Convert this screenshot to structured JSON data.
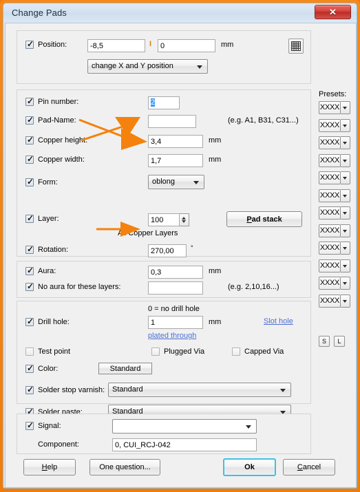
{
  "window": {
    "title": "Change Pads",
    "close_label": "✕",
    "accent_border": "#f0800f",
    "titlebar_color": "#d5e3f1",
    "close_color": "#c93a32"
  },
  "position_group": {
    "checkbox_label": "Position:",
    "checked": true,
    "x_value": "-8,5",
    "separator": "I",
    "y_value": "0",
    "unit": "mm",
    "mode_select": "change X and Y position",
    "grid_icon": "grid-icon"
  },
  "pad_group": {
    "pin_number": {
      "label": "Pin number:",
      "checked": true,
      "value": "2",
      "selected": true
    },
    "pad_name": {
      "label": "Pad-Name:",
      "checked": true,
      "value": "",
      "hint": "(e.g. A1, B31, C31...)"
    },
    "copper_height": {
      "label": "Copper height:",
      "checked": true,
      "value": "3,4",
      "unit": "mm"
    },
    "copper_width": {
      "label": "Copper width:",
      "checked": true,
      "value": "1,7",
      "unit": "mm"
    },
    "form": {
      "label": "Form:",
      "checked": true,
      "value": "oblong"
    },
    "layer": {
      "label": "Layer:",
      "checked": true,
      "value": "100",
      "caption": "All Copper Layers"
    },
    "pad_stack_button": {
      "accel": "P",
      "rest": "ad stack"
    },
    "rotation": {
      "label": "Rotation:",
      "checked": true,
      "value": "270,00",
      "unit": "°"
    }
  },
  "aura_group": {
    "aura": {
      "label": "Aura:",
      "checked": true,
      "value": "0,3",
      "unit": "mm"
    },
    "no_aura": {
      "label": "No aura for these layers:",
      "checked": true,
      "value": "",
      "hint": "(e.g. 2,10,16...)"
    }
  },
  "drill_group": {
    "caption": "0 = no drill hole",
    "drill_hole": {
      "label": "Drill hole:",
      "checked": true,
      "value": "1",
      "unit": "mm"
    },
    "slot_hole_link": "Slot hole",
    "plated_through_link": "plated through",
    "test_point": {
      "label": "Test point",
      "checked": false
    },
    "plugged_via": {
      "label": "Plugged Via",
      "checked": false
    },
    "capped_via": {
      "label": "Capped Via",
      "checked": false
    },
    "color": {
      "label": "Color:",
      "checked": true,
      "button": "Standard"
    },
    "solder_stop": {
      "label": "Solder stop varnish:",
      "checked": true,
      "value": "Standard"
    },
    "solder_paste": {
      "label": "Solder paste:",
      "checked": true,
      "value": "Standard"
    }
  },
  "signal_group": {
    "signal": {
      "label": "Signal:",
      "checked": true,
      "value": ""
    },
    "component": {
      "label": "Component:",
      "value": "0, CUI_RCJ-042"
    }
  },
  "presets": {
    "label": "Presets:",
    "items": [
      {
        "value": "XXXX"
      },
      {
        "value": "XXXX"
      },
      {
        "value": "XXXX"
      },
      {
        "value": "XXXX"
      },
      {
        "value": "XXXX"
      },
      {
        "value": "XXXX"
      },
      {
        "value": "XXXX"
      },
      {
        "value": "XXXX"
      },
      {
        "value": "XXXX"
      },
      {
        "value": "XXXX"
      },
      {
        "value": "XXXX"
      },
      {
        "value": "XXXX"
      }
    ],
    "save_button": "S",
    "load_button": "L"
  },
  "footer": {
    "help": {
      "accel": "H",
      "rest": "elp"
    },
    "one_question": "One question...",
    "ok": "Ok",
    "cancel": {
      "accel": "C",
      "rest": "ancel"
    }
  },
  "annotations": {
    "arrow_color": "#f4820d",
    "arrows": [
      {
        "name": "arrow-to-copper-height",
        "target": "3,4"
      },
      {
        "name": "arrow-to-copper-width",
        "target": "1,7"
      },
      {
        "name": "arrow-to-rotation",
        "target": "270,00"
      }
    ]
  }
}
